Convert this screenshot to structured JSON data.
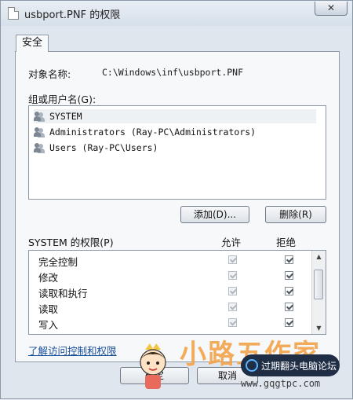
{
  "window": {
    "title": "usbport.PNF 的权限",
    "close_label": "✕"
  },
  "tab": {
    "label": "安全"
  },
  "object": {
    "label": "对象名称:",
    "value": "C:\\Windows\\inf\\usbport.PNF"
  },
  "groups": {
    "label": "组或用户名(G):",
    "items": [
      {
        "name": "SYSTEM"
      },
      {
        "name": "Administrators (Ray-PC\\Administrators)"
      },
      {
        "name": "Users (Ray-PC\\Users)"
      }
    ]
  },
  "buttons": {
    "add": "添加(D)...",
    "remove": "删除(R)",
    "ok": "确定",
    "cancel": "取消"
  },
  "permissions": {
    "title": "SYSTEM 的权限(P)",
    "allow_header": "允许",
    "deny_header": "拒绝",
    "rows": [
      {
        "name": "完全控制",
        "allow": true,
        "deny": true
      },
      {
        "name": "修改",
        "allow": true,
        "deny": true
      },
      {
        "name": "读取和执行",
        "allow": true,
        "deny": true
      },
      {
        "name": "读取",
        "allow": true,
        "deny": true
      },
      {
        "name": "写入",
        "allow": true,
        "deny": true
      }
    ]
  },
  "link": {
    "label": "了解访问控制和权限"
  },
  "watermark": {
    "brand": "小路五作家",
    "badge": "过期翻头电脑论坛",
    "url": "www.gqgtpc.com"
  }
}
